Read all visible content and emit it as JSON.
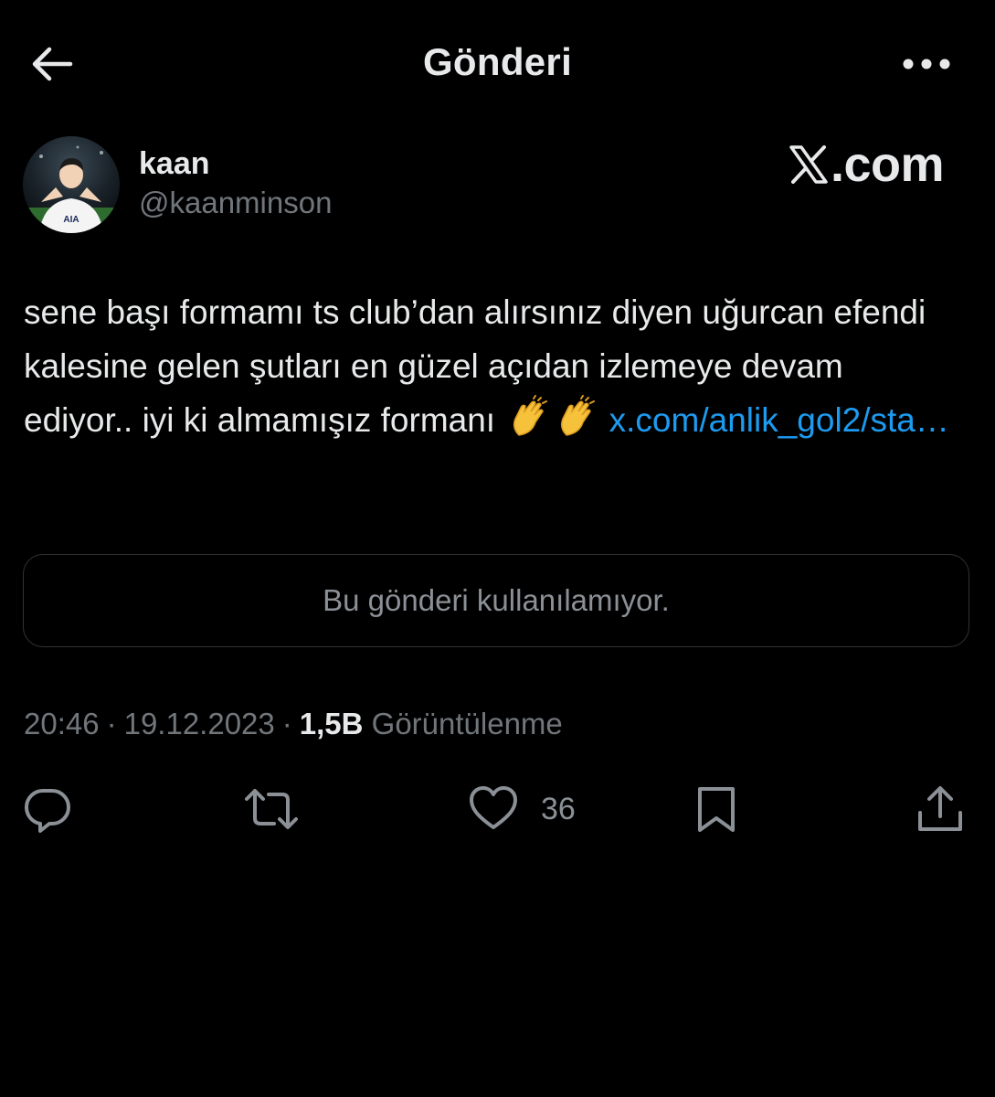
{
  "header": {
    "title": "Gönderi",
    "back_icon": "arrow-left-icon",
    "more_icon": "more-horizontal-icon"
  },
  "author": {
    "display_name": "kaan",
    "handle": "@kaanminson"
  },
  "watermark": {
    "text": ".com",
    "logo_icon": "x-logo-icon"
  },
  "tweet": {
    "text": "sene başı formamı ts club’dan alırsınız diyen uğurcan efendi kalesine gelen şutları en güzel açıdan izlemeye devam ediyor.. iyi ki almamışız formanı",
    "emoji": [
      "clapping-hands-emoji",
      "clapping-hands-emoji"
    ],
    "link_text": "x.com/anlik_gol2/sta…"
  },
  "quoted_card": {
    "message": "Bu gönderi kullanılamıyor."
  },
  "meta": {
    "time": "20:46",
    "date": "19.12.2023",
    "separator": "·",
    "views_count": "1,5B",
    "views_label": "Görüntülenme"
  },
  "actions": {
    "reply_icon": "reply-icon",
    "repost_icon": "repost-icon",
    "like_icon": "heart-icon",
    "like_count": "36",
    "bookmark_icon": "bookmark-icon",
    "share_icon": "share-icon"
  },
  "colors": {
    "background": "#000000",
    "text": "#e7e9ea",
    "secondary": "#71767b",
    "link": "#1d9bf0",
    "border": "#2f3336"
  }
}
